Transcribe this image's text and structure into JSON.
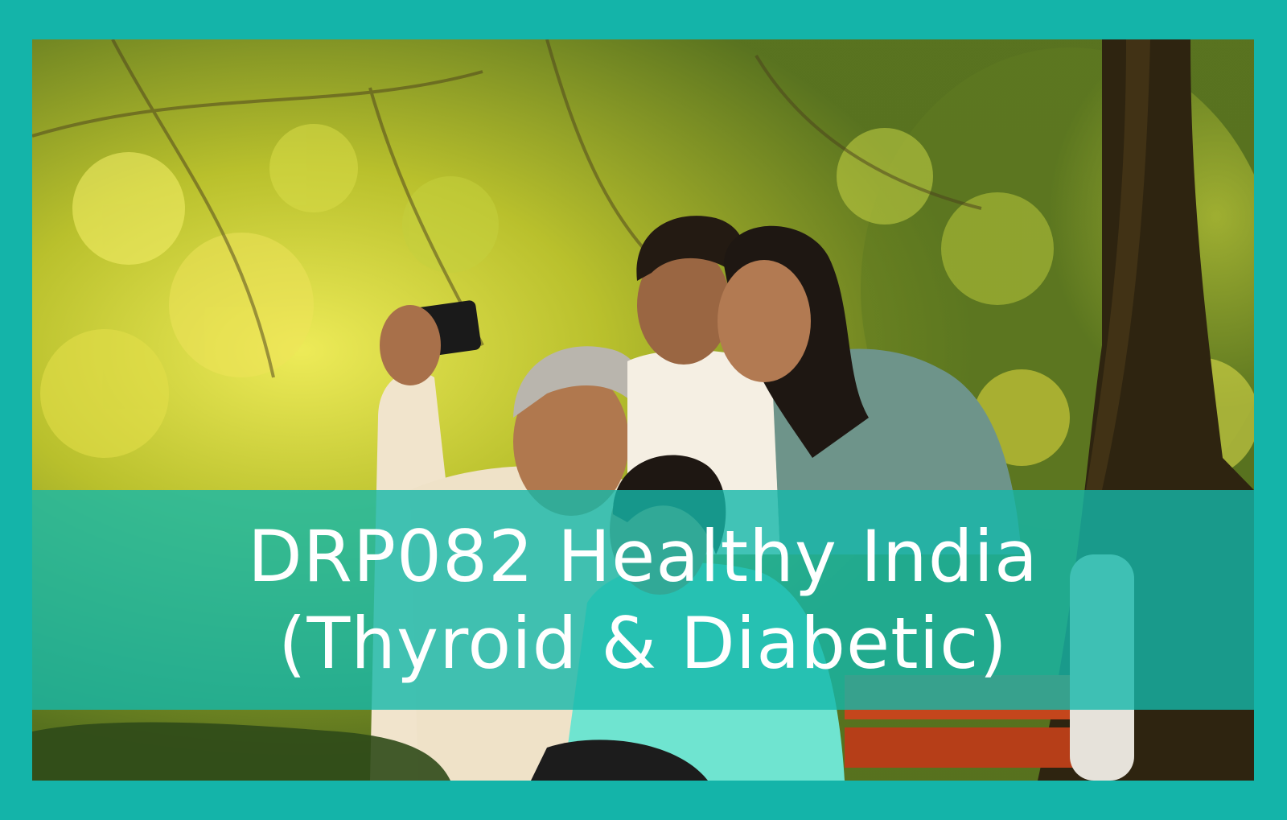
{
  "banner": {
    "line1": "DRP082 Healthy India",
    "line2": "(Thyroid & Diabetic)"
  },
  "colors": {
    "frame": "#14b4a9",
    "banner_overlay": "#14b8aa",
    "banner_text": "#ffffff",
    "foliage_light": "#d8d83a",
    "foliage_dark": "#4f6a1e",
    "tree_trunk": "#2e2410",
    "bench_red": "#c4461c"
  },
  "image": {
    "subject": "family-selfie-photo"
  }
}
